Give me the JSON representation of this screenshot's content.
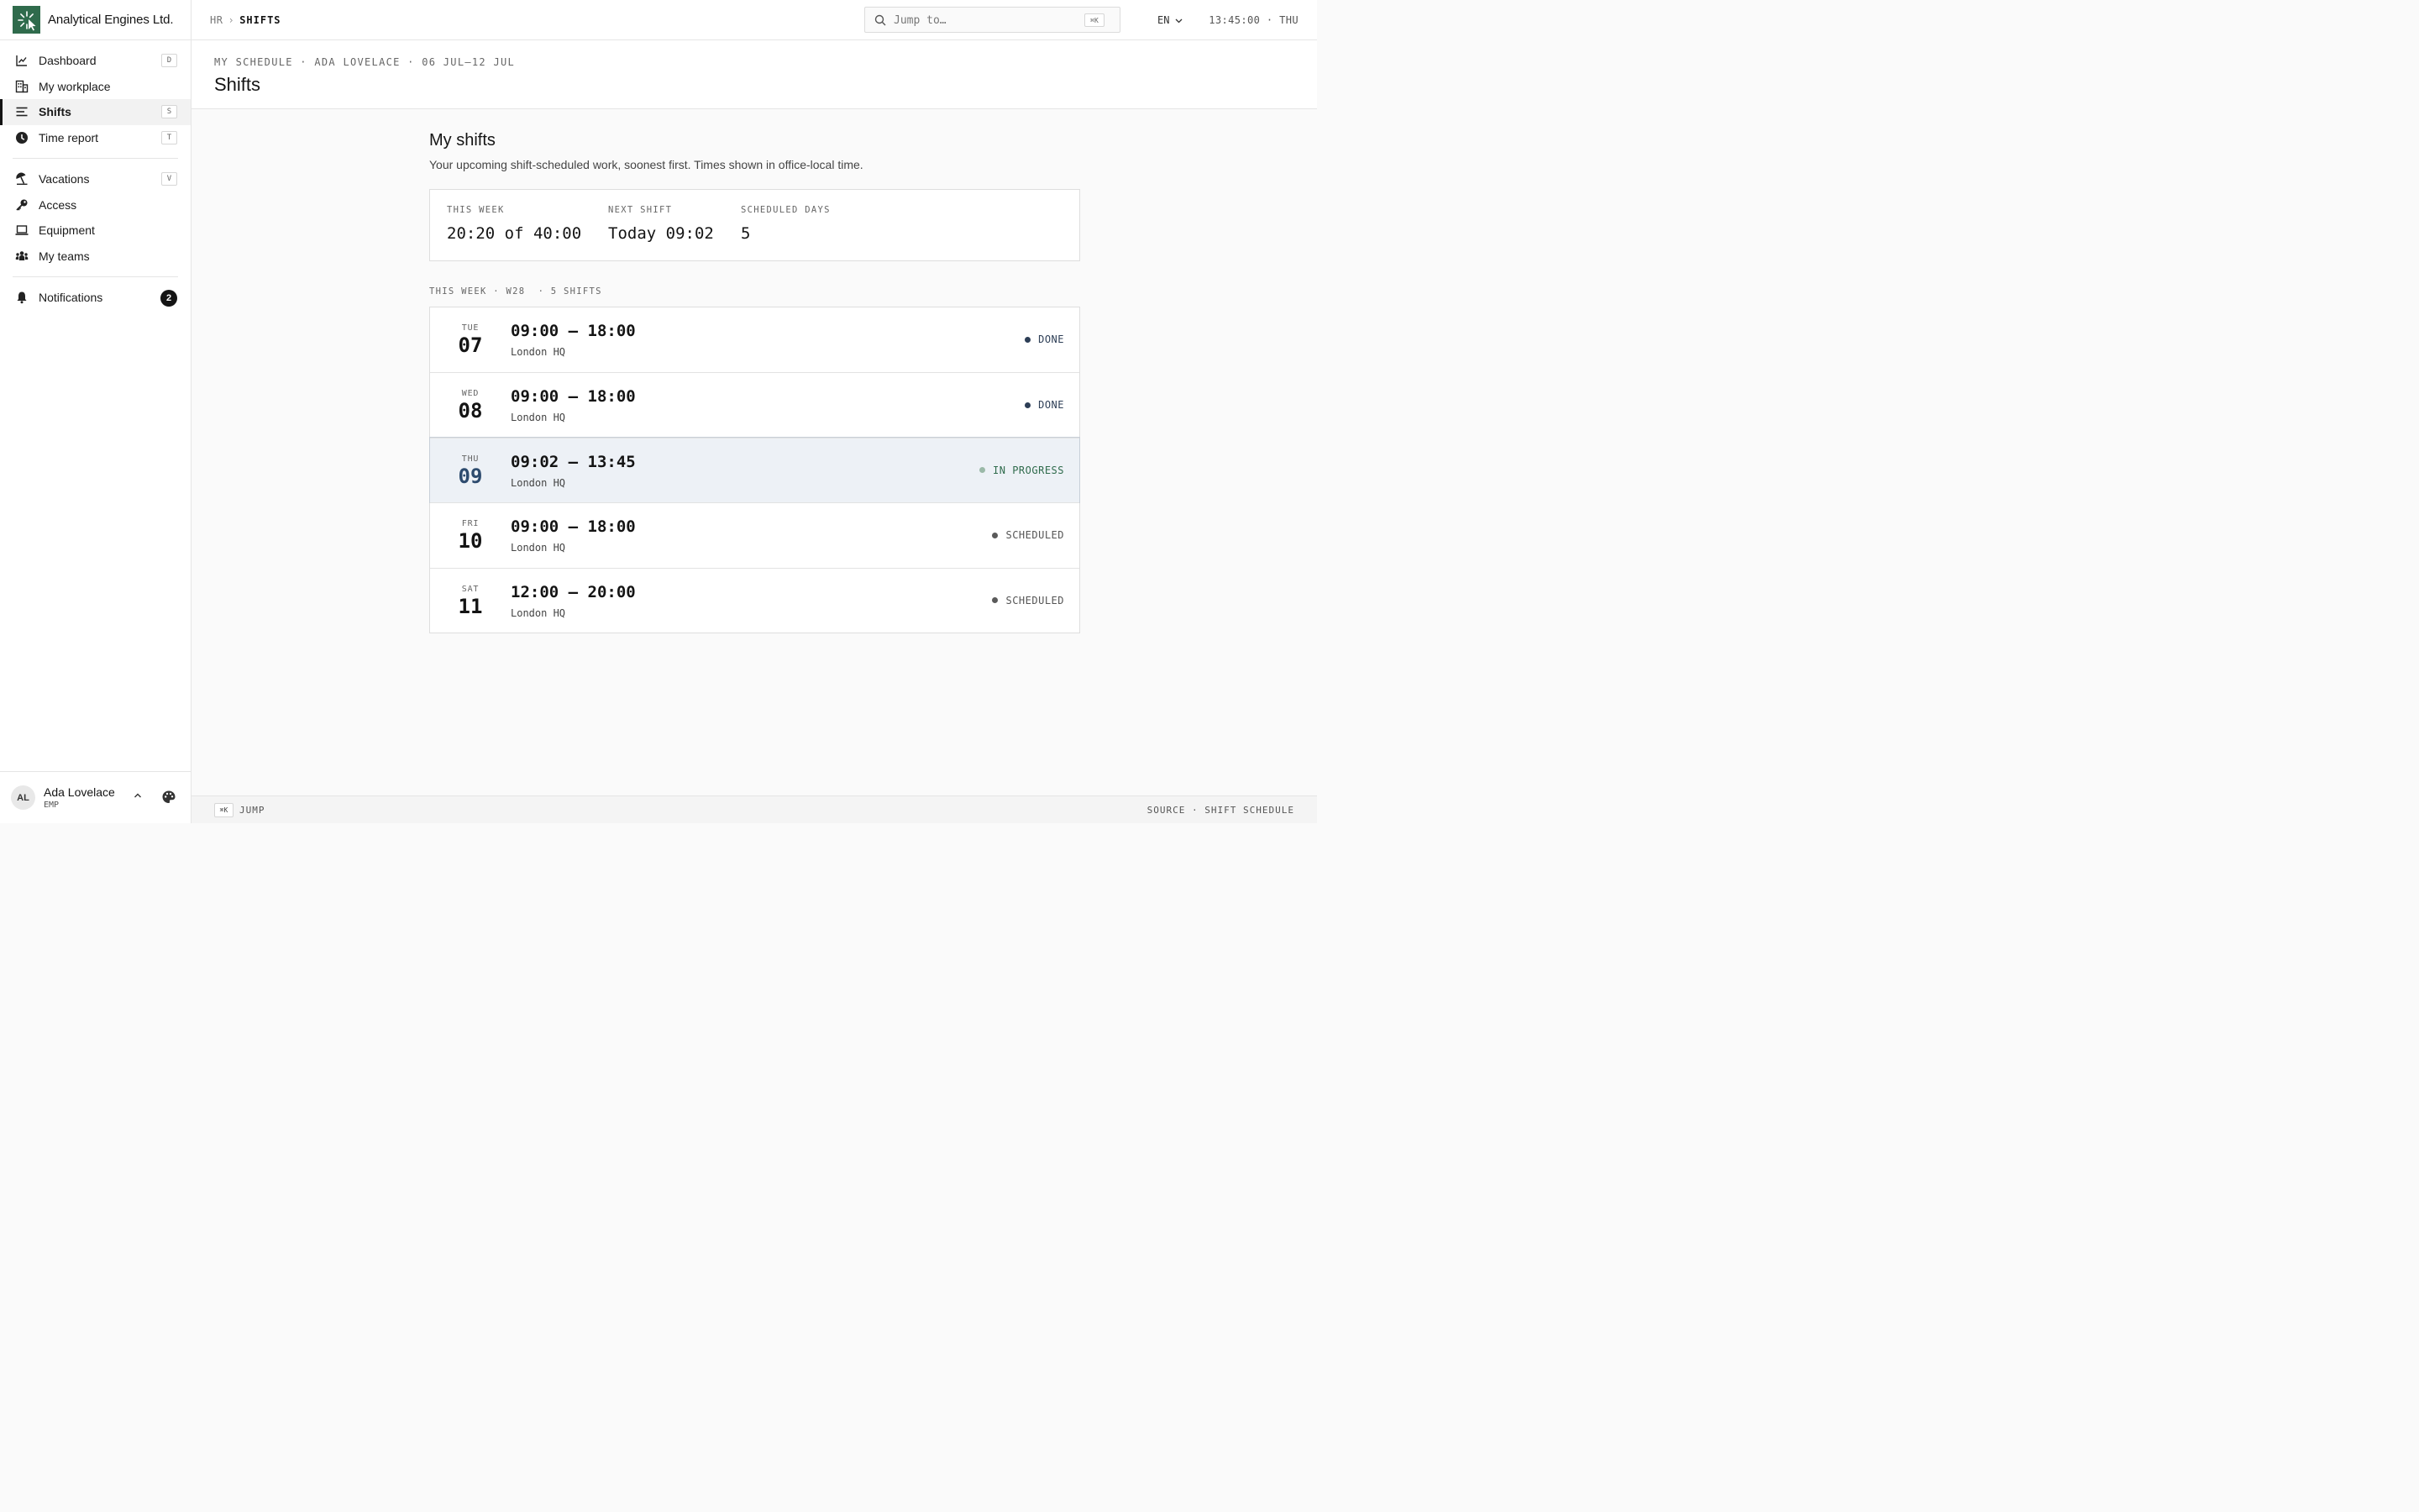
{
  "brand": {
    "name": "Analytical Engines Ltd."
  },
  "sidebar": {
    "items": [
      {
        "label": "Dashboard",
        "kbd": "D"
      },
      {
        "label": "My workplace"
      },
      {
        "label": "Shifts",
        "kbd": "S"
      },
      {
        "label": "Time report",
        "kbd": "T"
      },
      {
        "label": "Vacations",
        "kbd": "V"
      },
      {
        "label": "Access"
      },
      {
        "label": "Equipment"
      },
      {
        "label": "My teams"
      },
      {
        "label": "Notifications",
        "badge": "2"
      }
    ],
    "active": "Shifts"
  },
  "user": {
    "initials": "AL",
    "name": "Ada Lovelace",
    "role": "EMP"
  },
  "topbar": {
    "breadcrumb_parent": "HR",
    "breadcrumb_sep": "›",
    "breadcrumb_current": "SHIFTS",
    "search_placeholder": "Jump to…",
    "search_kbd": "⌘K",
    "language": "EN",
    "clock": "13:45:00 · THU"
  },
  "page": {
    "pretitle": "MY SCHEDULE · ADA LOVELACE · 06 JUL–12 JUL",
    "title": "Shifts"
  },
  "main": {
    "heading": "My shifts",
    "subtitle": "Your upcoming shift-scheduled work, soonest first. Times shown in office-local time.",
    "stats": [
      {
        "label": "THIS WEEK",
        "value": "20:20 of 40:00"
      },
      {
        "label": "NEXT SHIFT",
        "value": "Today 09:02"
      },
      {
        "label": "SCHEDULED DAYS",
        "value": "5"
      }
    ],
    "section_label": "THIS WEEK · W28  · 5 SHIFTS",
    "shifts": [
      {
        "dow": "TUE",
        "day": "07",
        "time": "09:00 – 18:00",
        "location": "London HQ",
        "status": "DONE"
      },
      {
        "dow": "WED",
        "day": "08",
        "time": "09:00 – 18:00",
        "location": "London HQ",
        "status": "DONE"
      },
      {
        "dow": "THU",
        "day": "09",
        "time": "09:02 – 13:45",
        "location": "London HQ",
        "status": "IN PROGRESS"
      },
      {
        "dow": "FRI",
        "day": "10",
        "time": "09:00 – 18:00",
        "location": "London HQ",
        "status": "SCHEDULED"
      },
      {
        "dow": "SAT",
        "day": "11",
        "time": "12:00 – 20:00",
        "location": "London HQ",
        "status": "SCHEDULED"
      }
    ]
  },
  "footer": {
    "kbd": "⌘K",
    "jump": "JUMP",
    "source": "SOURCE · SHIFT SCHEDULE"
  },
  "colors": {
    "brand": "#2f6b4c",
    "done": "#2d3e56",
    "in_progress": "#2f6b4c",
    "scheduled": "#5a5a5a",
    "current_row": "#edf1f6"
  }
}
